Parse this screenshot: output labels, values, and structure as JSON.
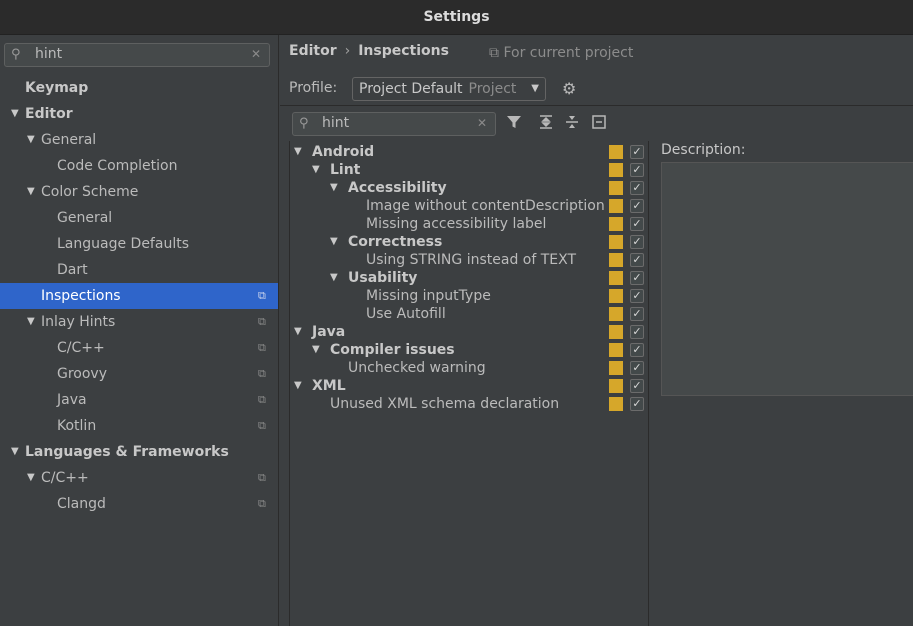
{
  "window": {
    "title": "Settings"
  },
  "sidebar": {
    "search": {
      "value": "hint"
    },
    "items": [
      {
        "label": "Keymap",
        "level": 0,
        "bold": true,
        "arrow": false,
        "selected": false,
        "copy": false
      },
      {
        "label": "Editor",
        "level": 0,
        "bold": true,
        "arrow": true,
        "selected": false,
        "copy": false
      },
      {
        "label": "General",
        "level": 1,
        "bold": false,
        "arrow": true,
        "selected": false,
        "copy": false
      },
      {
        "label": "Code Completion",
        "level": 2,
        "bold": false,
        "arrow": false,
        "selected": false,
        "copy": false
      },
      {
        "label": "Color Scheme",
        "level": 1,
        "bold": false,
        "arrow": true,
        "selected": false,
        "copy": false
      },
      {
        "label": "General",
        "level": 2,
        "bold": false,
        "arrow": false,
        "selected": false,
        "copy": false
      },
      {
        "label": "Language Defaults",
        "level": 2,
        "bold": false,
        "arrow": false,
        "selected": false,
        "copy": false
      },
      {
        "label": "Dart",
        "level": 2,
        "bold": false,
        "arrow": false,
        "selected": false,
        "copy": false
      },
      {
        "label": "Inspections",
        "level": 1,
        "bold": false,
        "arrow": false,
        "selected": true,
        "copy": true
      },
      {
        "label": "Inlay Hints",
        "level": 1,
        "bold": false,
        "arrow": true,
        "selected": false,
        "copy": true
      },
      {
        "label": "C/C++",
        "level": 2,
        "bold": false,
        "arrow": false,
        "selected": false,
        "copy": true
      },
      {
        "label": "Groovy",
        "level": 2,
        "bold": false,
        "arrow": false,
        "selected": false,
        "copy": true
      },
      {
        "label": "Java",
        "level": 2,
        "bold": false,
        "arrow": false,
        "selected": false,
        "copy": true
      },
      {
        "label": "Kotlin",
        "level": 2,
        "bold": false,
        "arrow": false,
        "selected": false,
        "copy": true
      },
      {
        "label": "Languages & Frameworks",
        "level": 0,
        "bold": true,
        "arrow": true,
        "selected": false,
        "copy": false
      },
      {
        "label": "C/C++",
        "level": 1,
        "bold": false,
        "arrow": true,
        "selected": false,
        "copy": true
      },
      {
        "label": "Clangd",
        "level": 2,
        "bold": false,
        "arrow": false,
        "selected": false,
        "copy": true
      }
    ]
  },
  "header": {
    "breadcrumb": [
      "Editor",
      "Inspections"
    ],
    "for_project": "For current project",
    "profile_label": "Profile:",
    "profile_value": "Project Default",
    "profile_scope": "Project"
  },
  "inspections": {
    "search": {
      "value": "hint"
    },
    "items": [
      {
        "label": "Android",
        "level": 0,
        "bold": true,
        "arrow": true,
        "checked": true
      },
      {
        "label": "Lint",
        "level": 1,
        "bold": true,
        "arrow": true,
        "checked": true
      },
      {
        "label": "Accessibility",
        "level": 2,
        "bold": true,
        "arrow": true,
        "checked": true
      },
      {
        "label": "Image without contentDescription",
        "level": 3,
        "bold": false,
        "arrow": false,
        "checked": true
      },
      {
        "label": "Missing accessibility label",
        "level": 3,
        "bold": false,
        "arrow": false,
        "checked": true
      },
      {
        "label": "Correctness",
        "level": 2,
        "bold": true,
        "arrow": true,
        "checked": true
      },
      {
        "label": "Using STRING instead of TEXT",
        "level": 3,
        "bold": false,
        "arrow": false,
        "checked": true
      },
      {
        "label": "Usability",
        "level": 2,
        "bold": true,
        "arrow": true,
        "checked": true
      },
      {
        "label": "Missing inputType",
        "level": 3,
        "bold": false,
        "arrow": false,
        "checked": true
      },
      {
        "label": "Use Autofill",
        "level": 3,
        "bold": false,
        "arrow": false,
        "checked": true
      },
      {
        "label": "Java",
        "level": 0,
        "bold": true,
        "arrow": true,
        "checked": true
      },
      {
        "label": "Compiler issues",
        "level": 1,
        "bold": true,
        "arrow": true,
        "checked": true
      },
      {
        "label": "Unchecked warning",
        "level": 2,
        "bold": false,
        "arrow": false,
        "checked": true
      },
      {
        "label": "XML",
        "level": 0,
        "bold": true,
        "arrow": true,
        "checked": true
      },
      {
        "label": "Unused XML schema declaration",
        "level": 1,
        "bold": false,
        "arrow": false,
        "checked": true
      }
    ]
  },
  "description": {
    "label": "Description:"
  },
  "colors": {
    "selection": "#2f65ca",
    "severity_warning": "#d6a72a",
    "background": "#3c3f41"
  }
}
